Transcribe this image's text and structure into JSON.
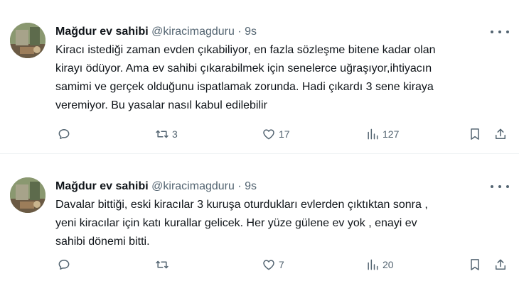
{
  "tweets": [
    {
      "display_name": "Mağdur ev sahibi",
      "handle": "@kiracimagduru",
      "separator": "·",
      "time": "9s",
      "text": "Kiracı istediği zaman evden çıkabiliyor, en fazla sözleşme bitene kadar olan\nkirayı ödüyor. Ama ev sahibi çıkarabilmek için senelerce uğraşıyor,ihtiyacın\nsamimi ve gerçek olduğunu ispatlamak zorunda. Hadi çıkardı 3 sene kiraya\nveremiyor. Bu yasalar nasıl kabul edilebilir",
      "replies": "",
      "retweets": "3",
      "likes": "17",
      "views": "127"
    },
    {
      "display_name": "Mağdur ev sahibi",
      "handle": "@kiracimagduru",
      "separator": "·",
      "time": "9s",
      "text": "Davalar bittiği, eski kiracılar 3 kuruşa oturdukları evlerden çıktıktan sonra ,\nyeni kiracılar için katı kurallar gelicek. Her yüze gülene ev yok , enayi ev\nsahibi dönemi bitti.",
      "replies": "",
      "retweets": "",
      "likes": "7",
      "views": "20"
    }
  ],
  "icons": {
    "reply": "comment-icon",
    "retweet": "retweet-icon",
    "like": "heart-icon",
    "views": "views-chart-icon",
    "bookmark": "bookmark-icon",
    "share": "share-icon",
    "more": "more-dots-icon"
  },
  "colors": {
    "text": "#0f1419",
    "secondary": "#536471",
    "divider": "#eff3f4"
  }
}
